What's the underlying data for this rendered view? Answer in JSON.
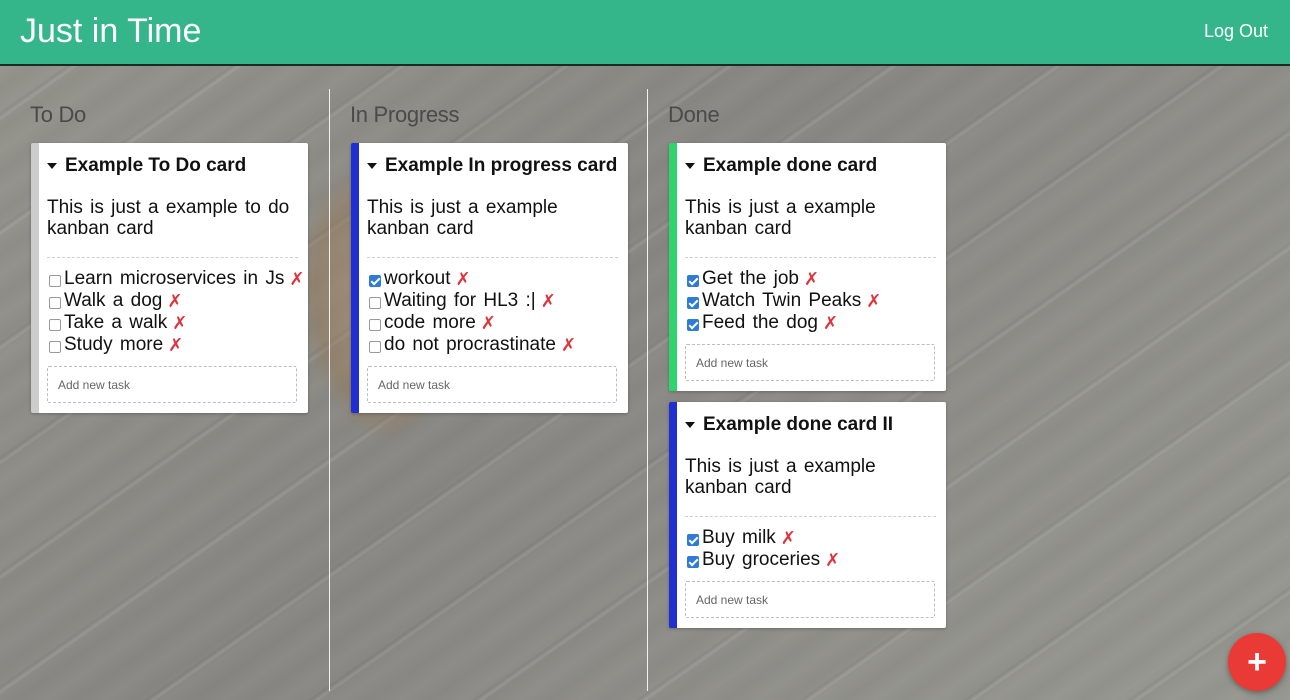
{
  "header": {
    "app_title": "Just in Time",
    "logout_label": "Log Out",
    "bar_color": "#35b58a"
  },
  "columns": [
    {
      "title": "To Do",
      "cards": [
        {
          "title": "Example To Do card",
          "description": "This is just a example to do kanban card",
          "accent_color": "#cccccc",
          "tasks": [
            {
              "label": "Learn microservices in Js",
              "done": false
            },
            {
              "label": "Walk a dog",
              "done": false
            },
            {
              "label": "Take a walk",
              "done": false
            },
            {
              "label": "Study more",
              "done": false
            }
          ],
          "add_placeholder": "Add new task"
        }
      ]
    },
    {
      "title": "In Progress",
      "cards": [
        {
          "title": "Example In progress card",
          "description": "This is just a example kanban card",
          "accent_color": "#1f2fd1",
          "tasks": [
            {
              "label": "workout",
              "done": true
            },
            {
              "label": "Waiting for HL3 :|",
              "done": false
            },
            {
              "label": "code more",
              "done": false
            },
            {
              "label": "do not procrastinate",
              "done": false
            }
          ],
          "add_placeholder": "Add new task"
        }
      ]
    },
    {
      "title": "Done",
      "cards": [
        {
          "title": "Example done card",
          "description": "This is just a example kanban card",
          "accent_color": "#2ed56f",
          "tasks": [
            {
              "label": "Get the job",
              "done": true
            },
            {
              "label": "Watch Twin Peaks",
              "done": true
            },
            {
              "label": "Feed the dog",
              "done": true
            }
          ],
          "add_placeholder": "Add new task"
        },
        {
          "title": "Example done card II",
          "description": "This is just a example kanban card",
          "accent_color": "#1f2fd1",
          "tasks": [
            {
              "label": "Buy milk",
              "done": true
            },
            {
              "label": "Buy groceries",
              "done": true
            }
          ],
          "add_placeholder": "Add new task"
        }
      ]
    }
  ],
  "delete_glyph": "✗",
  "fab": {
    "label": "+",
    "color": "#ea3a35"
  }
}
